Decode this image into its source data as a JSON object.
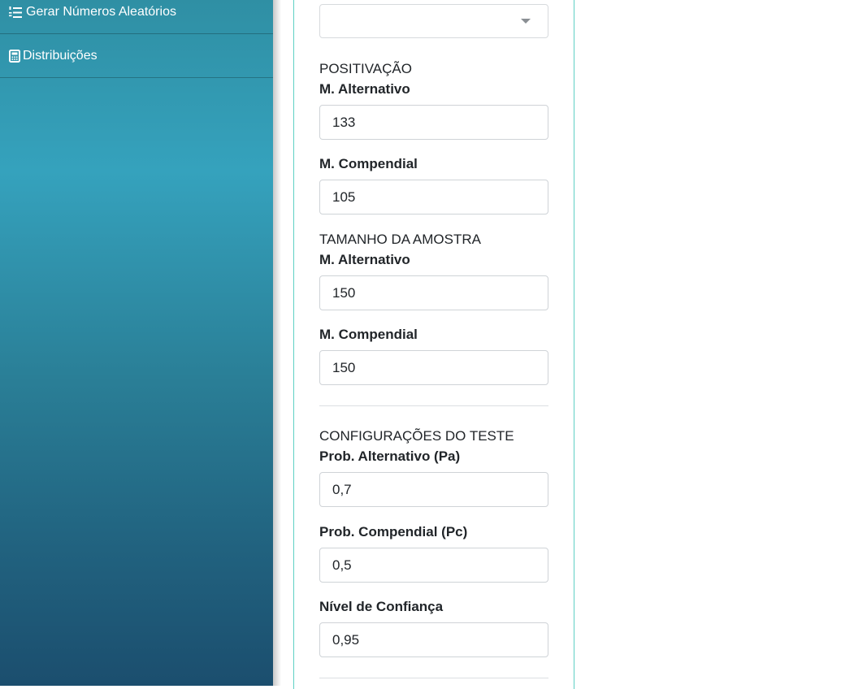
{
  "sidebar": {
    "items": [
      {
        "label": "Gerar Números Aleatórios",
        "icon": "list-ordered-icon"
      },
      {
        "label": "Distribuições",
        "icon": "calculator-icon"
      }
    ]
  },
  "form": {
    "select": {
      "value": ""
    },
    "positivacao": {
      "title": "POSITIVAÇÃO",
      "alt_label": "M. Alternativo",
      "alt_value": "133",
      "comp_label": "M. Compendial",
      "comp_value": "105"
    },
    "amostra": {
      "title": "TAMANHO DA AMOSTRA",
      "alt_label": "M. Alternativo",
      "alt_value": "150",
      "comp_label": "M. Compendial",
      "comp_value": "150"
    },
    "config": {
      "title": "CONFIGURAÇÕES DO TESTE",
      "pa_label": "Prob. Alternativo (Pa)",
      "pa_value": "0,7",
      "pc_label": "Prob. Compendial (Pc)",
      "pc_value": "0,5",
      "nc_label": "Nível de Confiança",
      "nc_value": "0,95"
    }
  }
}
